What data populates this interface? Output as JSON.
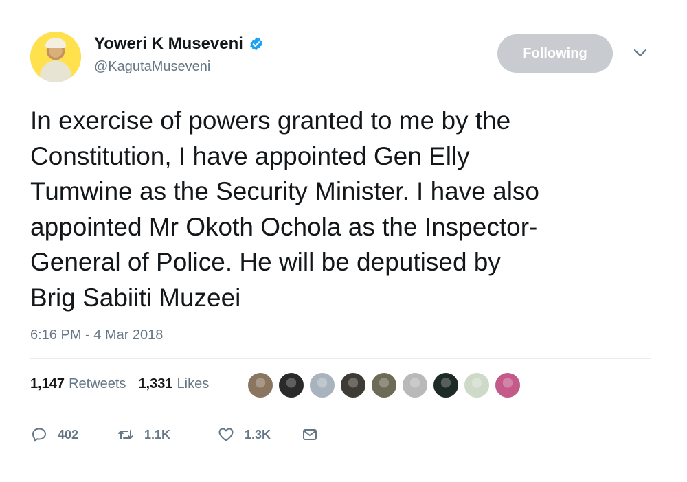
{
  "user": {
    "name": "Yoweri K Museveni",
    "handle": "@KagutaMuseveni",
    "verified": true
  },
  "follow_button": {
    "label": "Following"
  },
  "tweet": {
    "text": "In exercise of powers granted to me by the\nConstitution, I have appointed Gen Elly\nTumwine as the Security Minister. I have also\nappointed Mr Okoth Ochola as the Inspector-\nGeneral of Police. He will be deputised by\nBrig Sabiiti Muzeei",
    "timestamp": "6:16 PM - 4 Mar 2018"
  },
  "stats": {
    "retweets": {
      "count": "1,147",
      "label": "Retweets"
    },
    "likes": {
      "count": "1,331",
      "label": "Likes"
    }
  },
  "liker_avatars": [
    {
      "name": "liker-1",
      "color": "#8a7660"
    },
    {
      "name": "liker-2",
      "color": "#2a2a2a"
    },
    {
      "name": "liker-3",
      "color": "#a8b3bd"
    },
    {
      "name": "liker-4",
      "color": "#3d3b33"
    },
    {
      "name": "liker-5",
      "color": "#6d6a55"
    },
    {
      "name": "liker-6",
      "color": "#b9b9b9"
    },
    {
      "name": "liker-7",
      "color": "#1e2a25"
    },
    {
      "name": "liker-8",
      "color": "#cfd9c8"
    },
    {
      "name": "liker-9",
      "color": "#c45a8a"
    }
  ],
  "actions": {
    "reply": {
      "icon": "reply-icon",
      "count": "402"
    },
    "retweet": {
      "icon": "retweet-icon",
      "count": "1.1K"
    },
    "like": {
      "icon": "heart-icon",
      "count": "1.3K"
    },
    "message": {
      "icon": "envelope-icon"
    }
  },
  "colors": {
    "text": "#14171a",
    "secondary": "#657786",
    "verified": "#1da1f2",
    "follow_button_bg": "#c8ccd0",
    "divider": "#e6ecf0"
  }
}
